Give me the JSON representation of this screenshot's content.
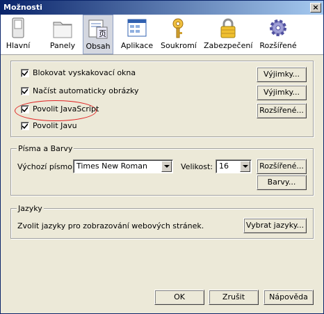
{
  "window": {
    "title": "Možnosti",
    "close_label": "×"
  },
  "toolbar": {
    "items": [
      {
        "label": "Hlavní",
        "icon": "switch-icon"
      },
      {
        "label": "Panely",
        "icon": "folder-icon"
      },
      {
        "label": "Obsah",
        "icon": "content-icon"
      },
      {
        "label": "Aplikace",
        "icon": "applications-icon"
      },
      {
        "label": "Soukromí",
        "icon": "privacy-key-icon"
      },
      {
        "label": "Zabezpečení",
        "icon": "padlock-icon"
      },
      {
        "label": "Rozšířené",
        "icon": "gear-icon"
      }
    ],
    "active_index": 2
  },
  "content": {
    "popups": {
      "label": "Blokovat vyskakovací okna",
      "checked": true,
      "button": "Výjimky..."
    },
    "images": {
      "label": "Načíst automaticky obrázky",
      "checked": true,
      "button": "Výjimky..."
    },
    "javascript": {
      "label": "Povolit JavaScript",
      "checked": true,
      "button": "Rozšířené..."
    },
    "java": {
      "label": "Povolit Javu",
      "checked": true
    }
  },
  "fonts": {
    "group_title": "Písma a Barvy",
    "default_font_label": "Výchozí písmo:",
    "default_font_value": "Times New Roman",
    "size_label": "Velikost:",
    "size_value": "16",
    "advanced_button": "Rozšířené...",
    "colors_button": "Barvy..."
  },
  "languages": {
    "group_title": "Jazyky",
    "description": "Zvolit jazyky pro zobrazování webových stránek.",
    "choose_button": "Vybrat jazyky..."
  },
  "footer": {
    "ok": "OK",
    "cancel": "Zrušit",
    "help": "Nápověda"
  },
  "colors": {
    "title_start": "#0a246a",
    "title_end": "#a6caf0",
    "highlight_ellipse": "#e02020"
  }
}
